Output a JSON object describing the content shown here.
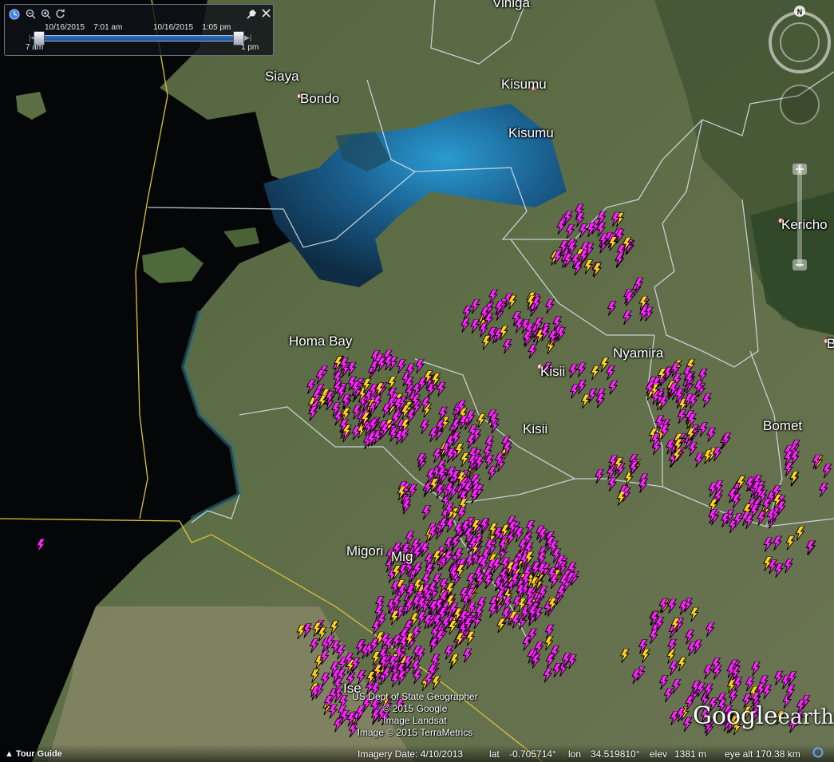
{
  "time_slider": {
    "start_date": "10/16/2015",
    "start_time": "7:01 am",
    "end_date": "10/16/2015",
    "end_time": "1:05 pm",
    "range_start": "7 am",
    "range_end": "1 pm"
  },
  "place_labels": [
    {
      "name": "Siaya"
    },
    {
      "name": "Bondo"
    },
    {
      "name": "Kisumu"
    },
    {
      "name": "Kisumu"
    },
    {
      "name": "Vihiga"
    },
    {
      "name": "Homa Bay"
    },
    {
      "name": "Kisii"
    },
    {
      "name": "Kisii"
    },
    {
      "name": "Nyamira"
    },
    {
      "name": "Bomet"
    },
    {
      "name": "Kericho"
    },
    {
      "name": "Migori"
    },
    {
      "name": "Mig"
    },
    {
      "name": "B"
    },
    {
      "name": "Ise"
    }
  ],
  "attribution": {
    "line1": "US Dept of State Geographer",
    "line2": "© 2015 Google",
    "line3": "Image Landsat",
    "line4": "Image © 2015 TerraMetrics"
  },
  "logo": {
    "bold": "Google",
    "light": "earth"
  },
  "status": {
    "tour_guide": "Tour Guide",
    "imagery_date": "Imagery Date: 4/10/2013",
    "lat_label": "lat",
    "lat_value": "-0.705714°",
    "lon_label": "lon",
    "lon_value": "34.519810°",
    "elev_label": "elev",
    "elev_value": "1381 m",
    "eye_alt": "eye alt 170.38 km"
  },
  "compass": {
    "north": "N"
  },
  "colors": {
    "lightning_magenta": "#ff22ff",
    "lightning_yellow": "#ffd21f",
    "lake_blue": "#1d6aa0",
    "water_dark": "#050608"
  },
  "icons": [
    "lightning-bolt-icon",
    "clock-icon",
    "zoom-out-icon",
    "zoom-in-icon",
    "refresh-icon",
    "wrench-icon",
    "close-icon",
    "compass-icon",
    "look-joystick-icon",
    "move-joystick-icon",
    "zoom-slider-icon",
    "globe-icon"
  ]
}
